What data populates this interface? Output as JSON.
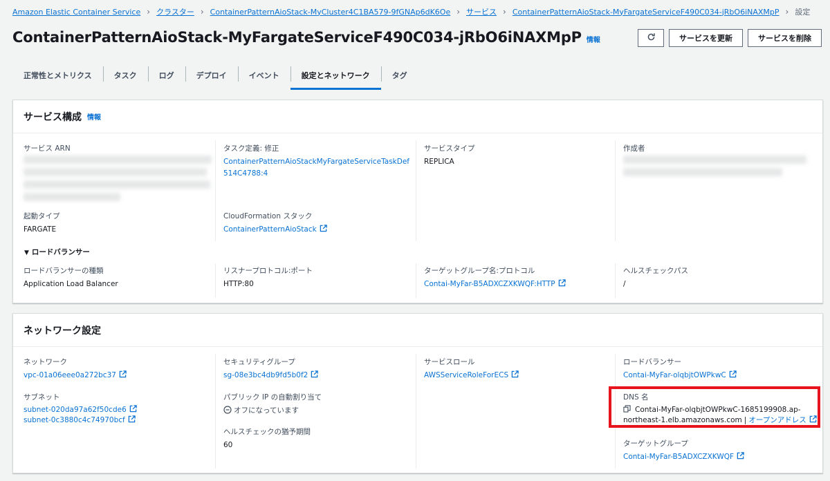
{
  "breadcrumb": {
    "items": [
      "Amazon Elastic Container Service",
      "クラスター",
      "ContainerPatternAioStack-MyCluster4C1BA579-9fGNAp6dK6Oe",
      "サービス",
      "ContainerPatternAioStack-MyFargateServiceF490C034-jRbO6iNAXMpP"
    ],
    "current": "設定"
  },
  "header": {
    "title": "ContainerPatternAioStack-MyFargateServiceF490C034-jRbO6iNAXMpP",
    "info": "情報",
    "refresh_icon": "refresh-icon",
    "update_button": "サービスを更新",
    "delete_button": "サービスを削除"
  },
  "tabs": [
    "正常性とメトリクス",
    "タスク",
    "ログ",
    "デプロイ",
    "イベント",
    "設定とネットワーク",
    "タグ"
  ],
  "active_tab": "設定とネットワーク",
  "service_config": {
    "title": "サービス構成",
    "info": "情報",
    "service_arn_label": "サービス ARN",
    "task_def_label": "タスク定義: 修正",
    "task_def_value": "ContainerPatternAioStackMyFargateServiceTaskDef514C4788:4",
    "service_type_label": "サービスタイプ",
    "service_type_value": "REPLICA",
    "created_by_label": "作成者",
    "launch_type_label": "起動タイプ",
    "launch_type_value": "FARGATE",
    "cfn_label": "CloudFormation スタック",
    "cfn_value": "ContainerPatternAioStack",
    "lb_toggle": "ロードバランサー",
    "lb_type_label": "ロードバランサーの種類",
    "lb_type_value": "Application Load Balancer",
    "listener_label": "リスナープロトコル:ポート",
    "listener_value": "HTTP:80",
    "tg_label": "ターゲットグループ名:プロトコル",
    "tg_value": "Contai-MyFar-B5ADXCZXKWQF:HTTP",
    "health_path_label": "ヘルスチェックパス",
    "health_path_value": "/"
  },
  "network": {
    "title": "ネットワーク設定",
    "network_label": "ネットワーク",
    "network_value": "vpc-01a06eee0a272bc37",
    "subnet_label": "サブネット",
    "subnet_values": [
      "subnet-020da97a62f50cde6",
      "subnet-0c3880c4c74970bcf"
    ],
    "sg_label": "セキュリティグループ",
    "sg_value": "sg-08e3bc4db9fd5b0f2",
    "public_ip_label": "パブリック IP の自動割り当て",
    "public_ip_value": "オフになっています",
    "grace_label": "ヘルスチェックの猶予期間",
    "grace_value": "60",
    "role_label": "サービスロール",
    "role_value": "AWSServiceRoleForECS",
    "lb_label": "ロードバランサー",
    "lb_value": "Contai-MyFar-olqbjtOWPkwC",
    "dns_label": "DNS 名",
    "dns_value_line1": "Contai-MyFar-olqbjtOWPkwC-1685199908.ap-",
    "dns_value_line2": "northeast-1.elb.amazonaws.com",
    "dns_open": "オープンアドレス",
    "tg_label": "ターゲットグループ",
    "tg_value": "Contai-MyFar-B5ADXCZXKWQF"
  },
  "colors": {
    "link": "#0972d3",
    "highlight": "#e8141d",
    "background": "#f2f3f3"
  }
}
